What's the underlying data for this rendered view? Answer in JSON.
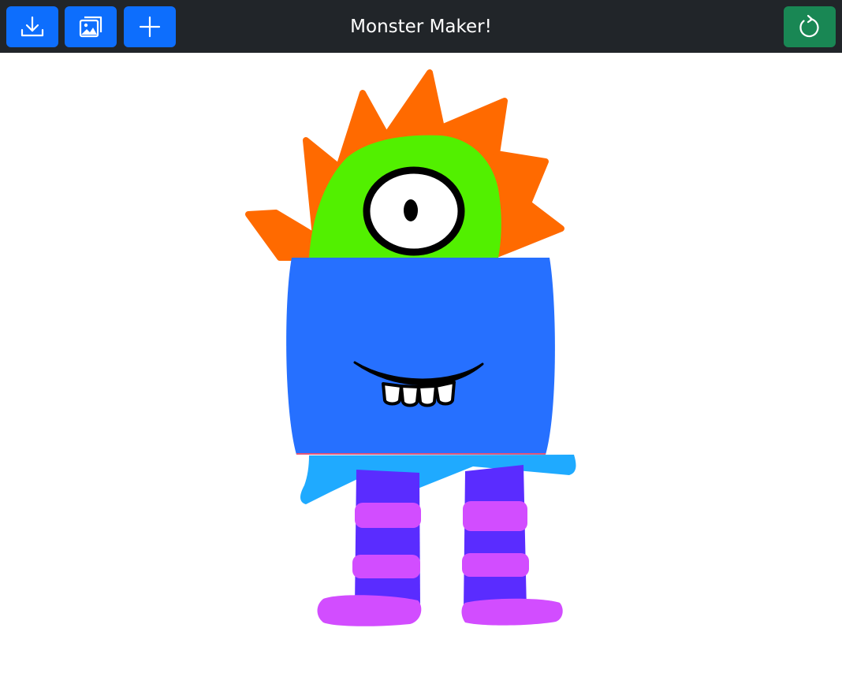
{
  "app": {
    "title": "Monster Maker!"
  },
  "toolbar": {
    "download": {
      "icon": "download-icon"
    },
    "gallery": {
      "icon": "images-icon"
    },
    "add": {
      "icon": "plus-icon"
    },
    "reset": {
      "icon": "refresh-icon"
    }
  },
  "colors": {
    "topbar": "#212529",
    "primary_button": "#0d6efd",
    "success_button": "#198754",
    "hair": "#ff6a00",
    "head": "#52f000",
    "body": "#2670ff",
    "skirt": "#1faaff",
    "leg_stripe_dark": "#5a2cff",
    "leg_stripe_light": "#d24dff"
  },
  "monster": {
    "parts": [
      "spiky-hair",
      "green-head",
      "single-eye",
      "blue-body",
      "smile-with-teeth",
      "skirt",
      "striped-legs",
      "purple-feet"
    ]
  }
}
